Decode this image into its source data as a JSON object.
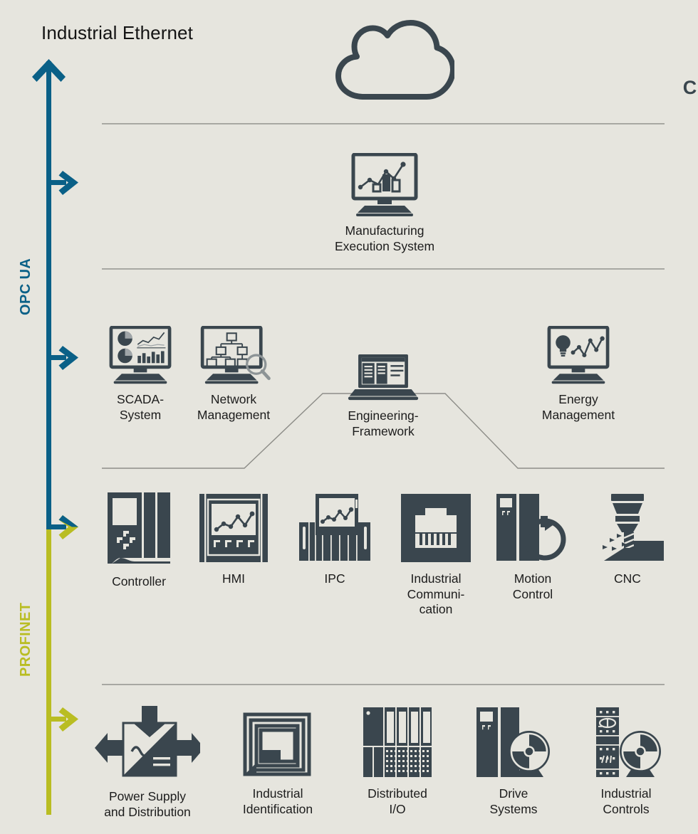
{
  "title": "Industrial Ethernet",
  "colors": {
    "background": "#e6e5de",
    "icon_dark": "#3a464e",
    "opcua_blue": "#0a6087",
    "profinet_olive": "#b9bd22",
    "divider_gray": "#9a9a95",
    "text": "#1c1c1c"
  },
  "axis": {
    "protocols": [
      {
        "name": "OPC UA",
        "color": "#0a6087"
      },
      {
        "name": "PROFINET",
        "color": "#b9bd22"
      }
    ],
    "opcua_label": "OPC UA",
    "profinet_label": "PROFINET"
  },
  "levels": [
    {
      "id": "cloud",
      "items": [
        {
          "id": "cloud",
          "label": "Cloud",
          "icon": "cloud-icon"
        }
      ]
    },
    {
      "id": "mes",
      "items": [
        {
          "id": "mes",
          "label": "Manufacturing\nExecution System",
          "icon": "desktop-chart-icon"
        }
      ]
    },
    {
      "id": "operations",
      "items": [
        {
          "id": "scada",
          "label": "SCADA-\nSystem",
          "icon": "desktop-dashboard-icon"
        },
        {
          "id": "network-management",
          "label": "Network\nManagement",
          "icon": "desktop-topology-magnifier-icon"
        },
        {
          "id": "engineering-framework",
          "label": "Engineering-\nFramework",
          "icon": "laptop-software-icon"
        },
        {
          "id": "energy-management",
          "label": "Energy\nManagement",
          "icon": "desktop-bulb-chart-icon"
        }
      ]
    },
    {
      "id": "automation",
      "items": [
        {
          "id": "controller",
          "label": "Controller",
          "icon": "plc-controller-icon"
        },
        {
          "id": "hmi",
          "label": "HMI",
          "icon": "hmi-panel-icon"
        },
        {
          "id": "ipc",
          "label": "IPC",
          "icon": "industrial-pc-icon"
        },
        {
          "id": "industrial-communication",
          "label": "Industrial\nCommuni-\ncation",
          "icon": "rj45-jack-icon"
        },
        {
          "id": "motion-control",
          "label": "Motion\nControl",
          "icon": "motion-drive-icon"
        },
        {
          "id": "cnc",
          "label": "CNC",
          "icon": "cnc-milling-icon"
        }
      ]
    },
    {
      "id": "field",
      "items": [
        {
          "id": "power-supply",
          "label": "Power Supply\nand Distribution",
          "icon": "ac-dc-converter-icon"
        },
        {
          "id": "industrial-identification",
          "label": "Industrial\nIdentification",
          "icon": "rfid-antenna-icon"
        },
        {
          "id": "distributed-io",
          "label": "Distributed\nI/O",
          "icon": "io-modules-icon"
        },
        {
          "id": "drive-systems",
          "label": "Drive\nSystems",
          "icon": "drive-motor-icon"
        },
        {
          "id": "industrial-controls",
          "label": "Industrial\nControls",
          "icon": "contactor-motor-icon"
        }
      ]
    }
  ]
}
